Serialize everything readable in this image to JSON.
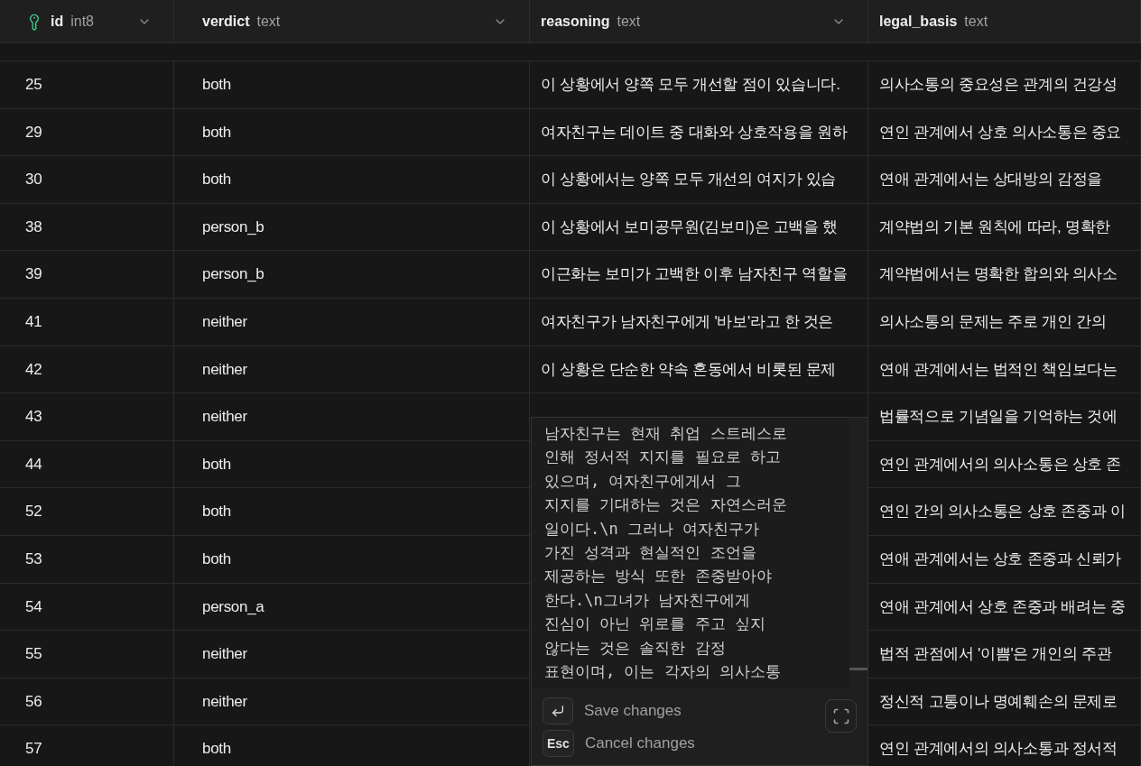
{
  "columns": [
    {
      "name": "id",
      "type": "int8",
      "primary_key": true
    },
    {
      "name": "verdict",
      "type": "text",
      "primary_key": false
    },
    {
      "name": "reasoning",
      "type": "text",
      "primary_key": false
    },
    {
      "name": "legal_basis",
      "type": "text",
      "primary_key": false
    }
  ],
  "rows": [
    {
      "id": "25",
      "verdict": "both",
      "reasoning": "이 상황에서 양쪽 모두 개선할 점이 있습니다.",
      "legal_basis": "의사소통의 중요성은 관계의 건강성"
    },
    {
      "id": "29",
      "verdict": "both",
      "reasoning": "여자친구는 데이트 중 대화와 상호작용을 원하",
      "legal_basis": "연인 관계에서 상호 의사소통은 중요"
    },
    {
      "id": "30",
      "verdict": "both",
      "reasoning": "이 상황에서는 양쪽 모두 개선의 여지가 있습",
      "legal_basis": "연애 관계에서는 상대방의 감정을"
    },
    {
      "id": "38",
      "verdict": "person_b",
      "reasoning": "이 상황에서 보미공무원(김보미)은 고백을 했",
      "legal_basis": "계약법의 기본 원칙에 따라, 명확한"
    },
    {
      "id": "39",
      "verdict": "person_b",
      "reasoning": "이근화는 보미가 고백한 이후 남자친구 역할을",
      "legal_basis": "계약법에서는 명확한 합의와 의사소"
    },
    {
      "id": "41",
      "verdict": "neither",
      "reasoning": "여자친구가 남자친구에게 '바보'라고 한 것은",
      "legal_basis": "의사소통의 문제는 주로 개인 간의"
    },
    {
      "id": "42",
      "verdict": "neither",
      "reasoning": "이 상황은 단순한 약속 혼동에서 비롯된 문제",
      "legal_basis": "연애 관계에서는 법적인 책임보다는"
    },
    {
      "id": "43",
      "verdict": "neither",
      "legal_basis": "법률적으로 기념일을 기억하는 것에"
    },
    {
      "id": "44",
      "verdict": "both",
      "legal_basis": "연인 관계에서의 의사소통은 상호 존"
    },
    {
      "id": "52",
      "verdict": "both",
      "legal_basis": "연인 간의 의사소통은 상호 존중과 이"
    },
    {
      "id": "53",
      "verdict": "both",
      "legal_basis": "연애 관계에서는 상호 존중과 신뢰가"
    },
    {
      "id": "54",
      "verdict": "person_a",
      "legal_basis": "연애 관계에서 상호 존중과 배려는 중"
    },
    {
      "id": "55",
      "verdict": "neither",
      "legal_basis": "법적 관점에서 '이쁨'은 개인의 주관"
    },
    {
      "id": "56",
      "verdict": "neither",
      "legal_basis": "정신적 고통이나 명예훼손의 문제로"
    },
    {
      "id": "57",
      "verdict": "both",
      "legal_basis": "연인 관계에서의 의사소통과 정서적"
    }
  ],
  "editor": {
    "value_lines": [
      "남자친구는 현재 취업 스트레스로",
      "인해 정서적 지지를 필요로 하고",
      "있으며, 여자친구에게서 그",
      "지지를 기대하는 것은 자연스러운",
      "일이다.\\n 그러나 여자친구가",
      "가진 성격과 현실적인 조언을",
      "제공하는 방식 또한 존중받아야",
      "한다.\\n그녀가 남자친구에게",
      "진심이 아닌 위로를 주고 싶지",
      "않다는 것은 솔직한 감정",
      "표현이며, 이는 각자의 의사소통"
    ],
    "actions": [
      {
        "kind": "save",
        "label": "Save changes"
      },
      {
        "kind": "cancel",
        "key": "Esc",
        "label": "Cancel changes"
      }
    ]
  }
}
